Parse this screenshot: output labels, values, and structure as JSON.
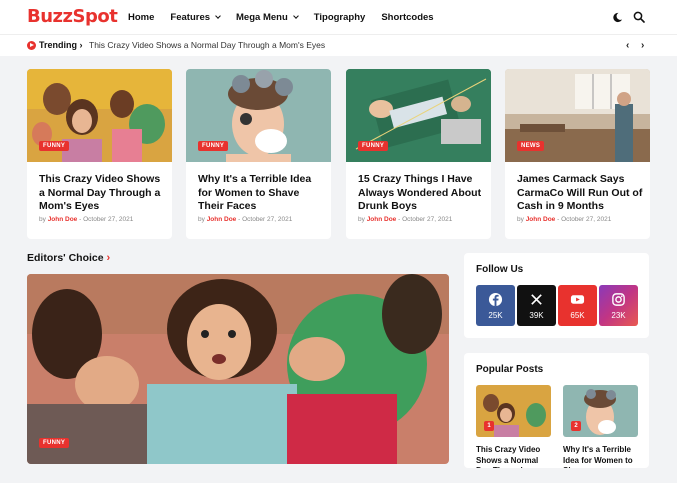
{
  "header": {
    "logo": "BuzzSpot",
    "nav": [
      {
        "label": "Home",
        "has_dropdown": false
      },
      {
        "label": "Features",
        "has_dropdown": true
      },
      {
        "label": "Mega Menu",
        "has_dropdown": true
      },
      {
        "label": "Tipography",
        "has_dropdown": false
      },
      {
        "label": "Shortcodes",
        "has_dropdown": false
      }
    ],
    "icons": [
      "theme-toggle-icon",
      "search-icon"
    ]
  },
  "trending": {
    "label": "Trending",
    "text": "This Crazy Video Shows a Normal Day Through a Mom's Eyes"
  },
  "cards": [
    {
      "badge": "FUNNY",
      "title": "This Crazy Video Shows a Normal Day Through a Mom's Eyes",
      "by": "by",
      "author": "John Doe",
      "date": "- October 27, 2021"
    },
    {
      "badge": "FUNNY",
      "title": "Why It's a Terrible Idea for Women to Shave Their Faces",
      "by": "by",
      "author": "John Doe",
      "date": "- October 27, 2021"
    },
    {
      "badge": "FUNNY",
      "title": "15 Crazy Things I Have Always Wondered About Drunk Boys",
      "by": "by",
      "author": "John Doe",
      "date": "- October 27, 2021"
    },
    {
      "badge": "NEWS",
      "title": "James Carmack Says CarmaCo Will Run Out of Cash in 9 Months",
      "by": "by",
      "author": "John Doe",
      "date": "- October 27, 2021"
    }
  ],
  "editors_choice": {
    "title": "Editors' Choice",
    "arrow": "›",
    "badge": "FUNNY"
  },
  "follow_us": {
    "title": "Follow Us",
    "networks": [
      {
        "name": "facebook",
        "icon": "facebook-icon",
        "count": "25K",
        "color": "#3b5998"
      },
      {
        "name": "x",
        "icon": "x-icon",
        "count": "39K",
        "color": "#111111"
      },
      {
        "name": "youtube",
        "icon": "youtube-icon",
        "count": "65K",
        "color": "#e8322e"
      },
      {
        "name": "instagram",
        "icon": "instagram-icon",
        "count": "23K",
        "color": "#c13584"
      }
    ]
  },
  "popular_posts": {
    "title": "Popular Posts",
    "items": [
      {
        "num": "1",
        "title": "This Crazy Video Shows a Normal Day Through a"
      },
      {
        "num": "2",
        "title": "Why It's a Terrible Idea for Women to Shave"
      }
    ]
  },
  "colors": {
    "accent": "#e8322e"
  }
}
